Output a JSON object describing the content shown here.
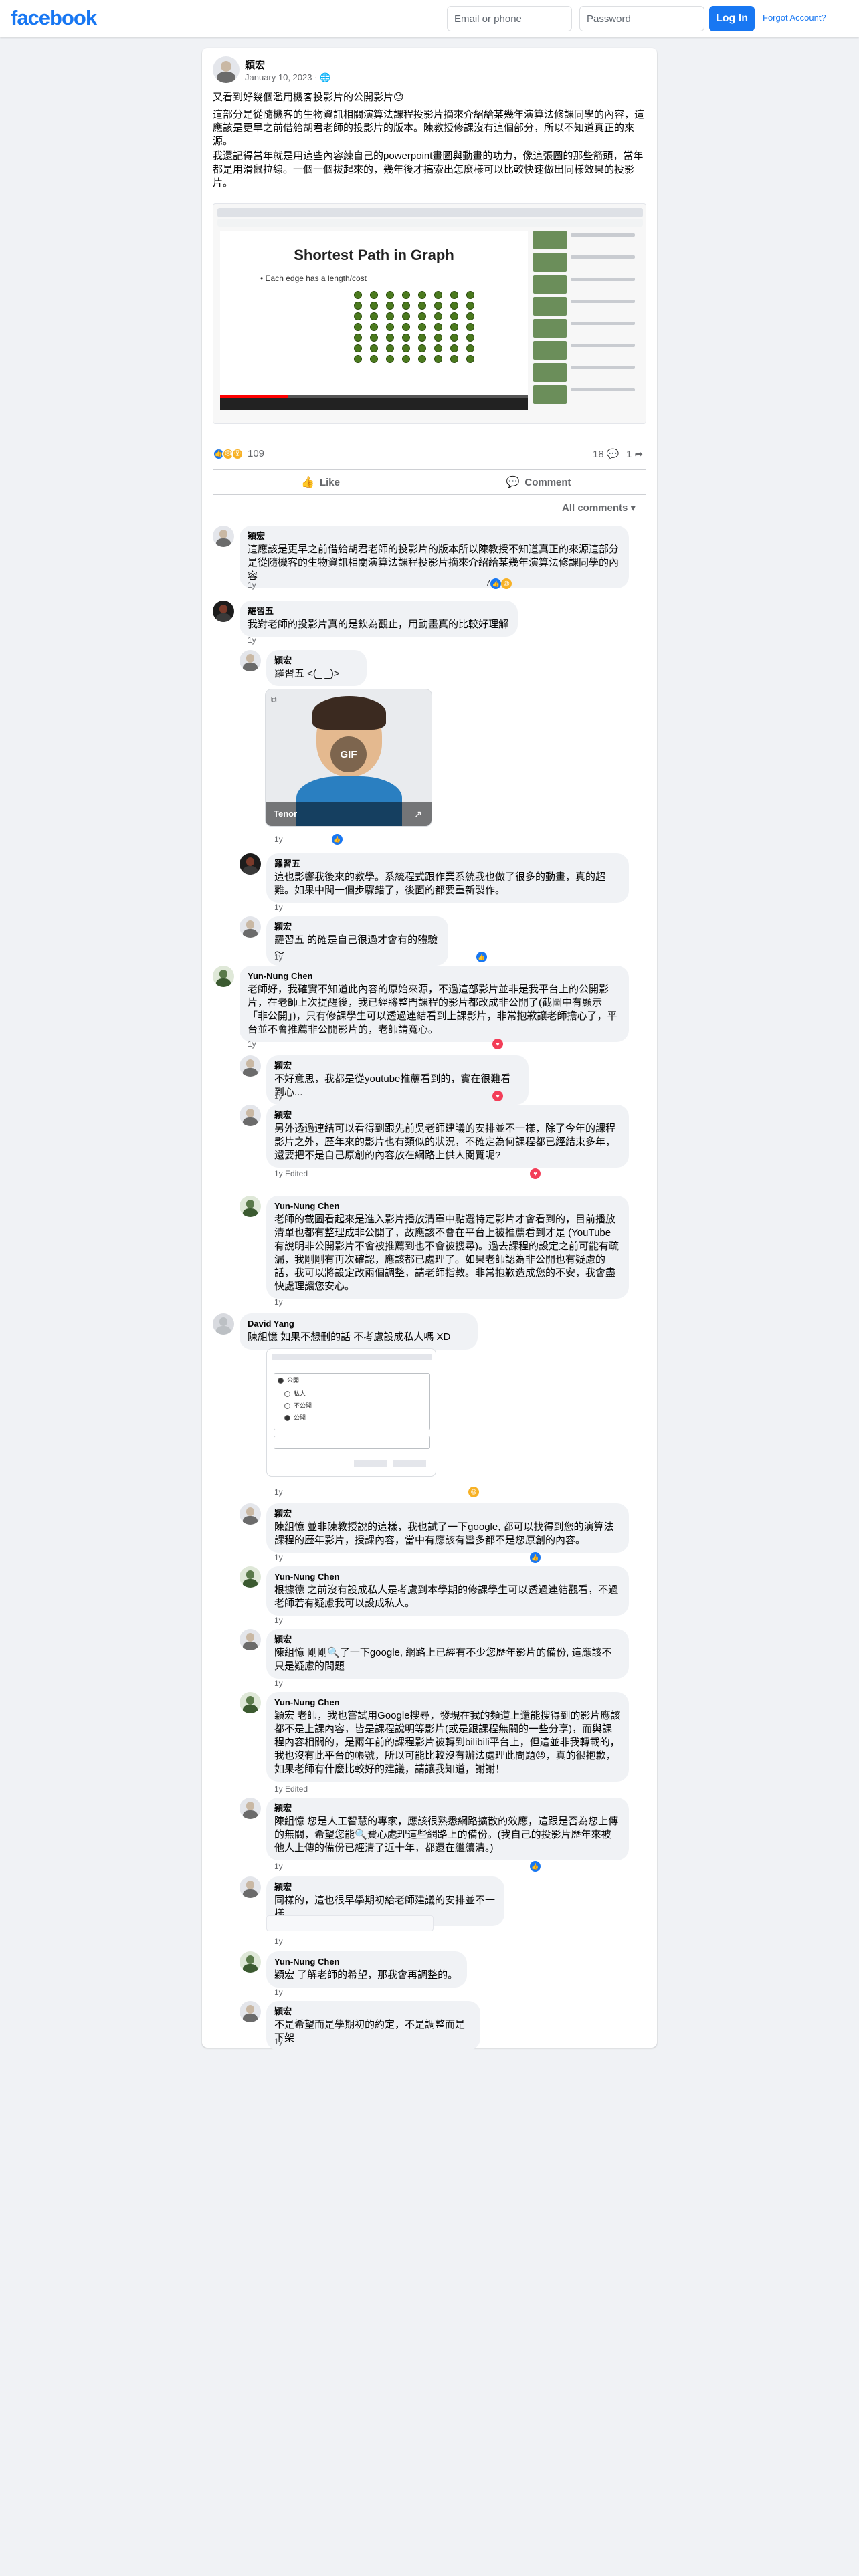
{
  "topbar": {
    "logo": "facebook",
    "email_placeholder": "Email or phone",
    "password_placeholder": "Password",
    "login_label": "Log In",
    "forgot_label": "Forgot Account?"
  },
  "post": {
    "author": "穎宏",
    "date": "January 10, 2023 · ",
    "privacy_icon": "globe-icon",
    "text1": "又看到好幾個濫用機客投影片的公開影片😓",
    "text2": "這部分是從隨機客的生物資訊相關演算法課程投影片摘來介紹給某幾年演算法修課同學的內容，這應該是更早之前借給胡君老師的投影片的版本。陳教授修課沒有這個部分，所以不知道真正的來源。",
    "text3": "我還記得當年就是用這些內容練自己的powerpoint畫圖與動畫的功力，像這張圖的那些箭頭，當年都是用滑鼠拉線。一個一個拔起來的，幾年後才搞索出怎麼樣可以比較快速做出同樣效果的投影片。",
    "image": {
      "slide_title": "Shortest Path in Graph",
      "slide_bullet": "• Each edge has a length/cost"
    },
    "reactions": {
      "count": "109",
      "comments": "18",
      "shares": "1"
    },
    "actions": {
      "like": "Like",
      "comment": "Comment"
    },
    "all_comments": "All comments ▾"
  },
  "comments": [
    {
      "author": "穎宏",
      "text": "這應該是更早之前借給胡君老師的投影片的版本所以陳教授不知道真正的來源這部分是從隨機客的生物資訊相關演算法課程投影片摘來介紹給某幾年演算法修課同學的內容",
      "meta": "1y",
      "reacts": "7"
    },
    {
      "author": "羅習五",
      "text": "我對老師的投影片真的是欽為觀止，用動畫真的比較好理解",
      "meta": "1y"
    },
    {
      "author": "穎宏",
      "text": "羅習五 <(_ _)>",
      "meta": "1y",
      "gif_label": "Tenor",
      "gif_badge": "GIF"
    },
    {
      "author": "羅習五",
      "text": "這也影響我後來的教學。系統程式跟作業系統我也做了很多的動畫，真的超難。如果中間一個步驟錯了，後面的都要重新製作。",
      "meta": "1y"
    },
    {
      "author": "穎宏",
      "text": "羅習五 的確是自己很過才會有的體驗～",
      "meta": "1y"
    },
    {
      "author": "Yun-Nung Chen",
      "text": "老師好，我確實不知道此內容的原始來源，不過這部影片並非是我平台上的公開影片，在老師上次提醒後，我已經將整門課程的影片都改成非公開了(截圖中有顯示「非公開」)，只有修課學生可以透過連結看到上課影片，非常抱歉讓老師擔心了，平台並不會推薦非公開影片的，老師請寬心。",
      "meta": "1y"
    },
    {
      "author": "穎宏",
      "text": "不好意思，我都是從youtube推薦看到的，實在很難看到心...",
      "meta": "1y"
    },
    {
      "author": "穎宏",
      "text": "另外透過連結可以看得到跟先前吳老師建議的安排並不一樣，除了今年的課程影片之外，歷年來的影片也有類似的狀況，不確定為何課程都已經結束多年，還要把不是自己原創的內容放在網路上供人閱覽呢?",
      "meta": "1y  Edited"
    },
    {
      "author": "Yun-Nung Chen",
      "text": "老師的截圖看起來是進入影片播放清單中點選特定影片才會看到的，目前播放清單也都有整理成非公開了，故應該不會在平台上被推薦看到才是 (YouTube有說明非公開影片不會被推薦到也不會被搜尋)。過去課程的設定之前可能有疏漏，我剛剛有再次確認，應該都已處理了。如果老師認為非公開也有疑慮的話，我可以將設定改兩個調整，請老師指教。非常抱歉造成您的不安，我會盡快處理讓您安心。",
      "meta": "1y"
    },
    {
      "author": "David Yang",
      "text": "陳組憶 如果不想刪的話 不考慮設成私人嗎 XD",
      "meta": "1y"
    },
    {
      "author": "穎宏",
      "text": "陳組憶 並非陳教授說的這樣，我也試了一下google, 都可以找得到您的演算法課程的歷年影片，授課內容，當中有應該有蠻多都不是您原創的內容。",
      "meta": "1y"
    },
    {
      "author": "Yun-Nung Chen",
      "text": "根據德 之前沒有設成私人是考慮到本學期的修課學生可以透過連結觀看，不過老師若有疑慮我可以設成私人。",
      "meta": "1y"
    },
    {
      "author": "穎宏",
      "text": "陳組憶 剛剛🔍了一下google, 網路上已經有不少您歷年影片的備份, 這應該不只是疑慮的問題",
      "meta": "1y"
    },
    {
      "author": "Yun-Nung Chen",
      "text": "穎宏 老師，我也嘗試用Google搜尋，發現在我的頻道上還能搜得到的影片應該都不是上課內容，皆是課程說明等影片(或是跟課程無關的一些分享)，而與課程內容相關的，是兩年前的課程影片被轉到bilibili平台上，但這並非我轉載的，我也沒有此平台的帳號，所以可能比較沒有辦法處理此問題😓，真的很抱歉，如果老師有什麼比較好的建議，請讓我知道，謝謝！",
      "meta": "1y  Edited"
    },
    {
      "author": "穎宏",
      "text": "陳組憶 您是人工智慧的專家，應該很熟悉網路擴散的效應，這跟是否為您上傳的無關，希望您能🔍費心處理這些網路上的備份。(我自己的投影片歷年來被他人上傳的備份已經清了近十年，都還在繼續清。)",
      "meta": "1y"
    },
    {
      "author": "穎宏",
      "text": "同樣的，這也很早學期初給老師建議的安排並不一樣",
      "meta": "1y"
    },
    {
      "author": "Yun-Nung Chen",
      "text": "穎宏 了解老師的希望，那我會再調整的。",
      "meta": "1y"
    },
    {
      "author": "穎宏",
      "text": "不是希望而是學期初的約定，不是調整而是下架",
      "meta": "1y"
    }
  ],
  "attachment_options": [
    "公開",
    "私人",
    "不公開",
    "公開"
  ],
  "colors": {
    "brand": "#1877f2",
    "bubble": "#f0f2f5"
  }
}
